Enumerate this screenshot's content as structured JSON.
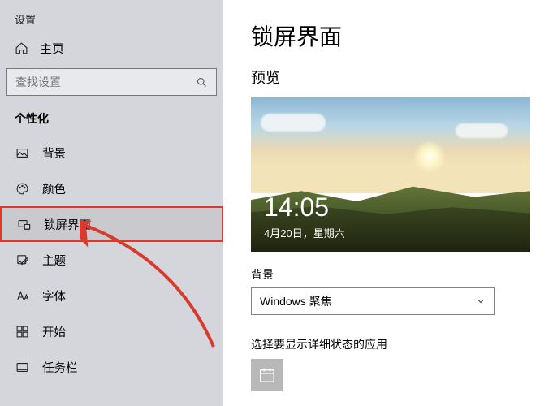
{
  "sidebar": {
    "appTitle": "设置",
    "homeLabel": "主页",
    "searchPlaceholder": "查找设置",
    "sectionLabel": "个性化",
    "items": [
      {
        "label": "背景",
        "icon": "image-icon"
      },
      {
        "label": "颜色",
        "icon": "palette-icon"
      },
      {
        "label": "锁屏界面",
        "icon": "lockscreen-icon",
        "selected": true
      },
      {
        "label": "主题",
        "icon": "theme-icon"
      },
      {
        "label": "字体",
        "icon": "font-icon"
      },
      {
        "label": "开始",
        "icon": "start-icon"
      },
      {
        "label": "任务栏",
        "icon": "taskbar-icon"
      }
    ]
  },
  "main": {
    "title": "锁屏界面",
    "previewLabel": "预览",
    "preview": {
      "time": "14:05",
      "date": "4月20日，星期六"
    },
    "bgLabel": "背景",
    "bgDropdown": "Windows 聚焦",
    "statusLabel": "选择要显示详细状态的应用"
  },
  "annotation": {
    "highlightColor": "#d83a2f"
  }
}
